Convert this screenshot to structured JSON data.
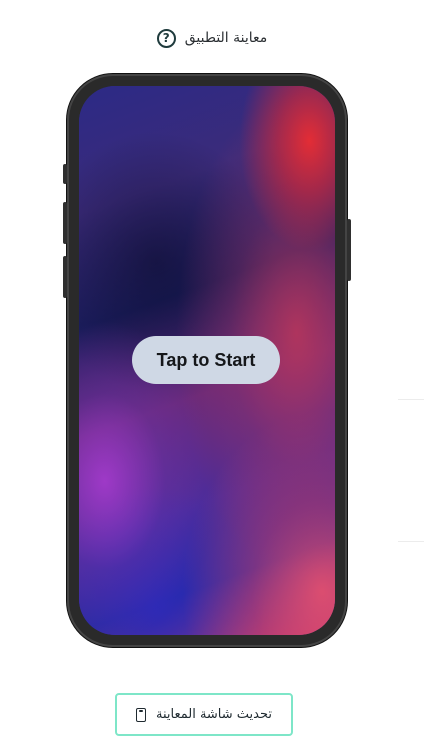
{
  "header": {
    "title": "معاينة التطبيق",
    "help_icon": "?"
  },
  "preview": {
    "start_button_label": "Tap to Start"
  },
  "footer": {
    "refresh_button_label": "تحديث شاشة المعاينة",
    "refresh_icon": "mobile-device-icon"
  },
  "colors": {
    "accent_border": "#7ee6c8",
    "header_text": "#2b2f33",
    "start_button_bg": "#cfd8e5"
  }
}
